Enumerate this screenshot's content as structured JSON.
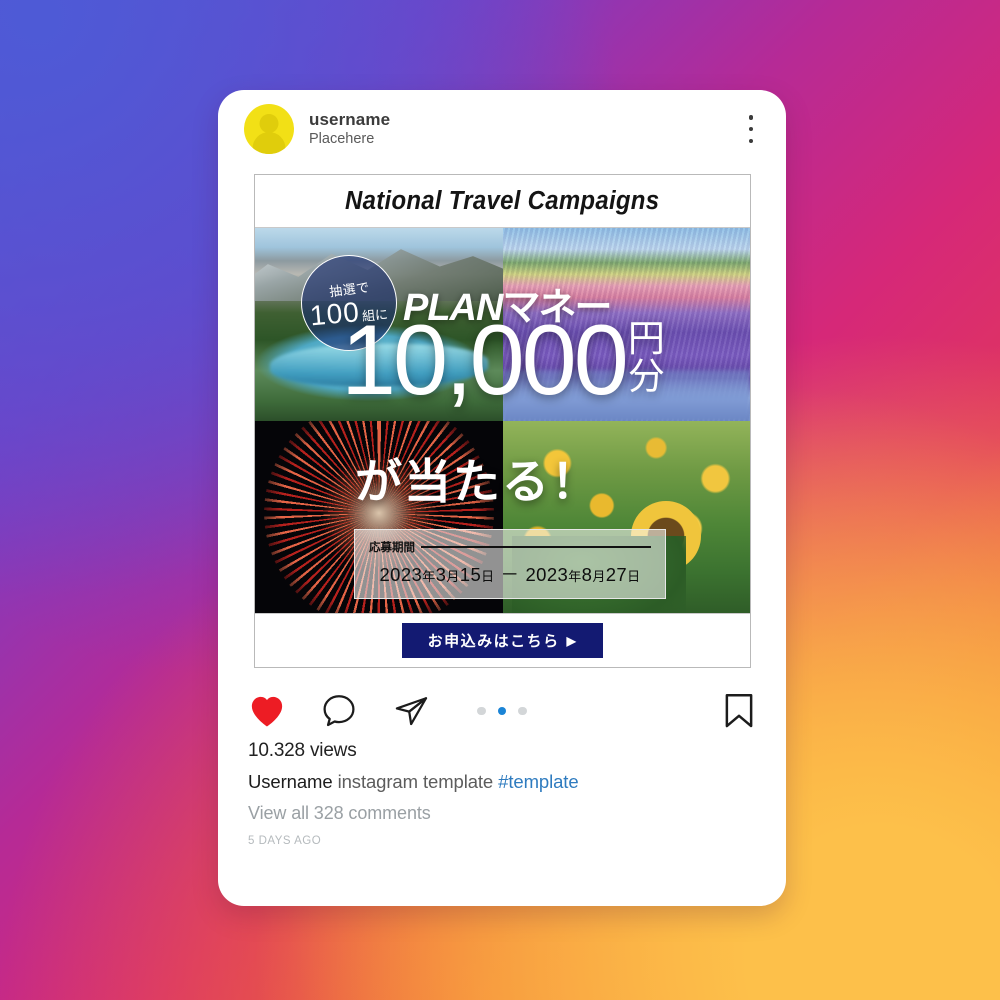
{
  "background": {
    "gradient_from": "#5158d6",
    "gradient_mid": "#d62878",
    "gradient_to": "#fdc04a"
  },
  "post": {
    "header": {
      "username": "username",
      "subtitle": "Placehere",
      "more_menu_label": "⋮"
    },
    "banner": {
      "title": "National Travel Campaigns",
      "badge": {
        "top_text": "抽選で",
        "number": "100",
        "suffix": "組に"
      },
      "headline_plan_en": "PLAN",
      "headline_plan_jp": "マネー",
      "amount": "10,000",
      "unit_top": "円",
      "unit_bottom": "分",
      "headline_win": "が当たる！",
      "period": {
        "label": "応募期間",
        "start_year": "2023",
        "start_year_unit": "年",
        "start_month": "3",
        "start_month_unit": "月",
        "start_day": "15",
        "start_day_unit": "日",
        "dash": "－",
        "end_year": "2023",
        "end_year_unit": "年",
        "end_month": "8",
        "end_month_unit": "月",
        "end_day": "27",
        "end_day_unit": "日"
      },
      "cta_label": "お申込みはこちら",
      "cta_arrow": "▶",
      "cta_bg_color": "#131a72"
    },
    "actions": {
      "like_icon": "heart-icon",
      "like_color": "#ed1c24",
      "comment_icon": "comment-icon",
      "share_icon": "share-icon",
      "save_icon": "bookmark-icon",
      "carousel_total": 3,
      "carousel_active_index": 1,
      "carousel_active_color": "#1a84d6",
      "carousel_inactive_color": "#d3d6d8"
    },
    "caption": {
      "views": "10.328 views",
      "author": "Username",
      "text": "instagram template",
      "hashtag": "#template",
      "hashtag_color": "#2e7bbf",
      "comments_link": "View all 328 comments",
      "timestamp": "5 DAYS AGO"
    }
  }
}
